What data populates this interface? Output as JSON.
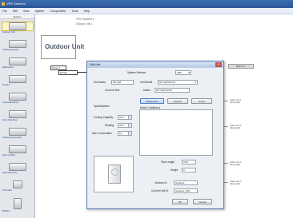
{
  "app": {
    "title": "VRV Selector"
  },
  "menu": [
    "File",
    "Edit",
    "View",
    "System",
    "Components",
    "Tools",
    "Help"
  ],
  "palette": {
    "header": "System",
    "items": [
      {
        "label": "Outdoor Unit"
      },
      {
        "label": "Ceiling Cassette"
      },
      {
        "label": "Wall Mount"
      },
      {
        "label": "Ducted"
      },
      {
        "label": "Concealed Duct"
      },
      {
        "label": "Floor Standing"
      },
      {
        "label": "Ceiling Suspended"
      },
      {
        "label": "Floor Ceiling"
      },
      {
        "label": "Heat Recovery"
      },
      {
        "label": "Controller"
      },
      {
        "label": "BS Box"
      }
    ]
  },
  "canvas": {
    "title": "VRV System 1",
    "subtitle": "Outdoor Unit 1",
    "outdoor_unit_label": "Outdoor Unit",
    "box1": "System 1",
    "box2": "RXYQ8",
    "readout": "Branch 1",
    "notes": [
      "Indoor unit 1",
      "Pipe length",
      "Indoor unit 2",
      "Pipe length",
      "Indoor unit 3",
      "Pipe length",
      "Indoor unit 4",
      "Pipe length"
    ]
  },
  "dialog": {
    "title": "Edit Unit",
    "close_glyph": "✕",
    "system_selector_label": "System Selector",
    "system_selector_value": "VRV",
    "unit_name_label": "Unit Name",
    "unit_name_value": "RXYQ8",
    "unit_model_label": "Unit Model",
    "unit_model_value": "RXYQ8TAYDN",
    "current_heat_label": "Current Heat",
    "model_label": "Model",
    "model_value": "RXYQ8TAYDN",
    "specifications_label": "Specifications",
    "tab_parameters": "Parameters",
    "tab_options": "Options",
    "tab_notes": "Notes",
    "notes_label": "Notes / Additional",
    "cooling_capacity_label": "Cooling Capacity",
    "cooling_capacity_value": "22.4",
    "heating_label": "Heating",
    "heating_value": "25.0",
    "max_connectable_label": "Max Connectable",
    "max_connectable_value": "13",
    "pipe_length_label": "Pipe Length",
    "pipe_length_value": "0.00",
    "height_label": "Height",
    "height_value": "0",
    "outdoor_id_label": "Outdoor ID",
    "outdoor_id_value": "System1",
    "current_unit_id_label": "Current Unit ID",
    "current_unit_id_value": "System1_001",
    "ok_label": "OK",
    "cancel_label": "Cancel"
  }
}
